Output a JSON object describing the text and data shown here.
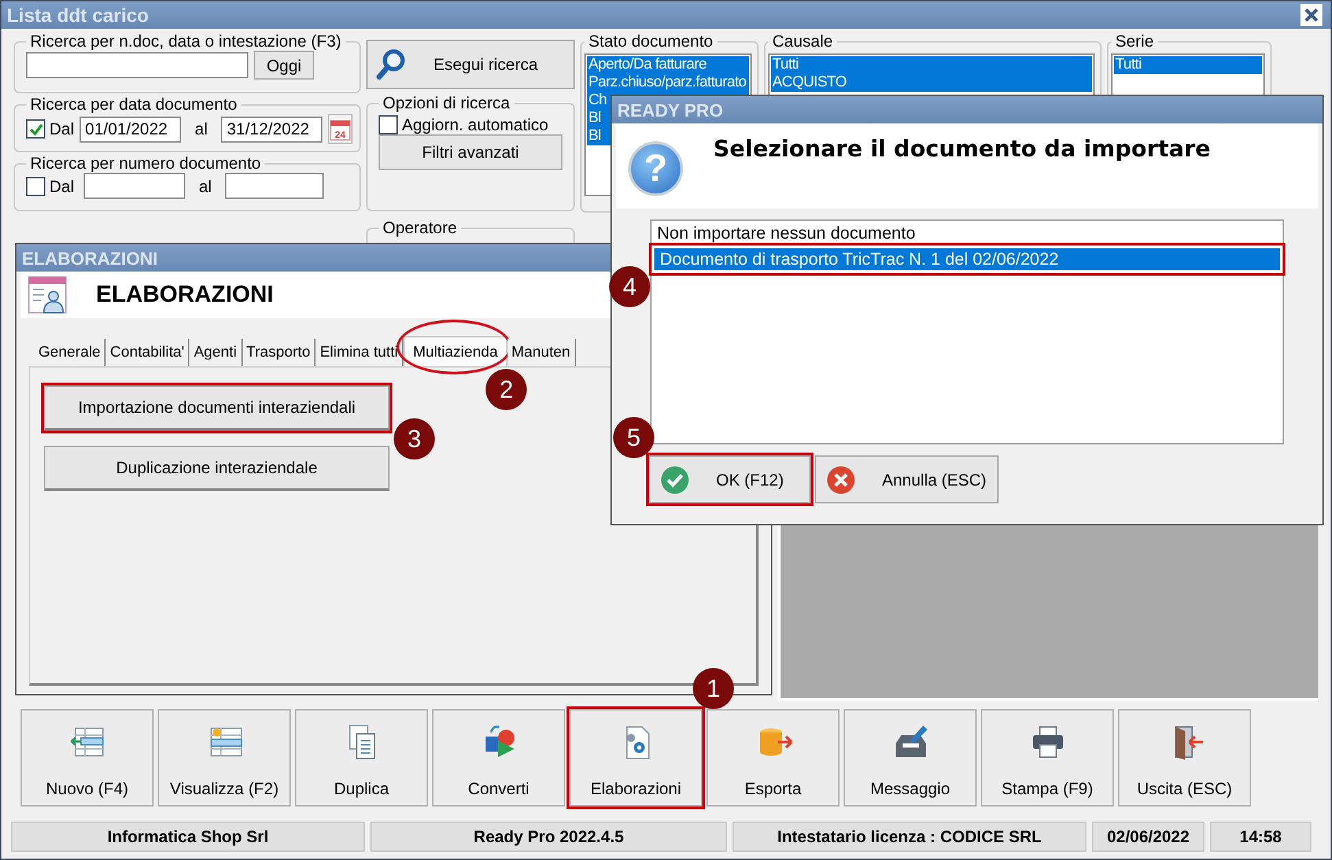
{
  "window": {
    "title": "Lista ddt carico"
  },
  "search": {
    "legend": "Ricerca per n.doc, data o intestazione (F3)",
    "today_button": "Oggi",
    "run_button": "Esegui ricerca"
  },
  "date_search": {
    "legend": "Ricerca per data documento",
    "checkbox": {
      "label": "Dal",
      "checked": true
    },
    "from": "01/01/2022",
    "to_label": "al",
    "to": "31/12/2022",
    "calendar_day": "24"
  },
  "number_search": {
    "legend": "Ricerca per numero documento",
    "checkbox": {
      "label": "Dal",
      "checked": false
    },
    "to_label": "al"
  },
  "options": {
    "legend": "Opzioni di ricerca",
    "checkbox": {
      "label": "Aggiorn. automatico",
      "checked": false
    },
    "button": "Filtri avanzati"
  },
  "operator": {
    "legend": "Operatore"
  },
  "filters": [
    {
      "legend": "Stato documento",
      "items": [
        {
          "label": "Aperto/Da fatturare",
          "selected": true
        },
        {
          "label": "Parz.chiuso/parz.fatturato",
          "selected": true
        },
        {
          "label": "Ch",
          "selected": true
        },
        {
          "label": "Bl",
          "selected": true
        },
        {
          "label": "Bl",
          "selected": true
        }
      ]
    },
    {
      "legend": "Causale",
      "items": [
        {
          "label": "Tutti",
          "selected": true
        },
        {
          "label": "ACQUISTO",
          "selected": true
        }
      ]
    },
    {
      "legend": "Serie",
      "items": [
        {
          "label": "Tutti",
          "selected": true
        }
      ]
    }
  ],
  "elaborazioni_window": {
    "title": "ELABORAZIONI",
    "heading": "ELABORAZIONI",
    "tabs": [
      {
        "label": "Generale",
        "selected": false
      },
      {
        "label": "Contabilita'",
        "selected": false
      },
      {
        "label": "Agenti",
        "selected": false
      },
      {
        "label": "Trasporto",
        "selected": false
      },
      {
        "label": "Elimina tutti",
        "selected": false
      },
      {
        "label": "Multiazienda",
        "selected": true,
        "highlighted": true,
        "callout": "2"
      },
      {
        "label": "Manuten",
        "selected": false
      }
    ],
    "actions": [
      {
        "label": "Importazione documenti interaziendali",
        "highlighted": true,
        "callout": "3"
      },
      {
        "label": "Duplicazione interaziendale"
      }
    ]
  },
  "dialog": {
    "title": "READY PRO",
    "icon_glyph": "?",
    "message": "Selezionare il documento da importare",
    "options": [
      {
        "label": "Non importare nessun documento",
        "selected": false
      },
      {
        "label": "Documento di trasporto TricTrac N. 1 del 02/06/2022",
        "selected": true,
        "highlighted": true,
        "callout": "4"
      }
    ],
    "buttons": [
      {
        "label": "OK (F12)",
        "kind": "ok",
        "highlighted": true,
        "callout": "5"
      },
      {
        "label": "Annulla (ESC)",
        "kind": "cancel"
      }
    ]
  },
  "toolbar": [
    {
      "label": "Nuovo (F4)",
      "kind": "new"
    },
    {
      "label": "Visualizza (F2)",
      "kind": "view"
    },
    {
      "label": "Duplica",
      "kind": "duplicate"
    },
    {
      "label": "Converti",
      "kind": "convert"
    },
    {
      "label": "Elaborazioni",
      "kind": "process",
      "highlighted": true,
      "callout": "1"
    },
    {
      "label": "Esporta",
      "kind": "export"
    },
    {
      "label": "Messaggio",
      "kind": "message"
    },
    {
      "label": "Stampa (F9)",
      "kind": "print"
    },
    {
      "label": "Uscita (ESC)",
      "kind": "exit"
    }
  ],
  "status_bar": [
    "Informatica Shop Srl",
    "Ready Pro 2022.4.5",
    "Intestatario licenza : CODICE SRL",
    "02/06/2022",
    "14:58"
  ]
}
